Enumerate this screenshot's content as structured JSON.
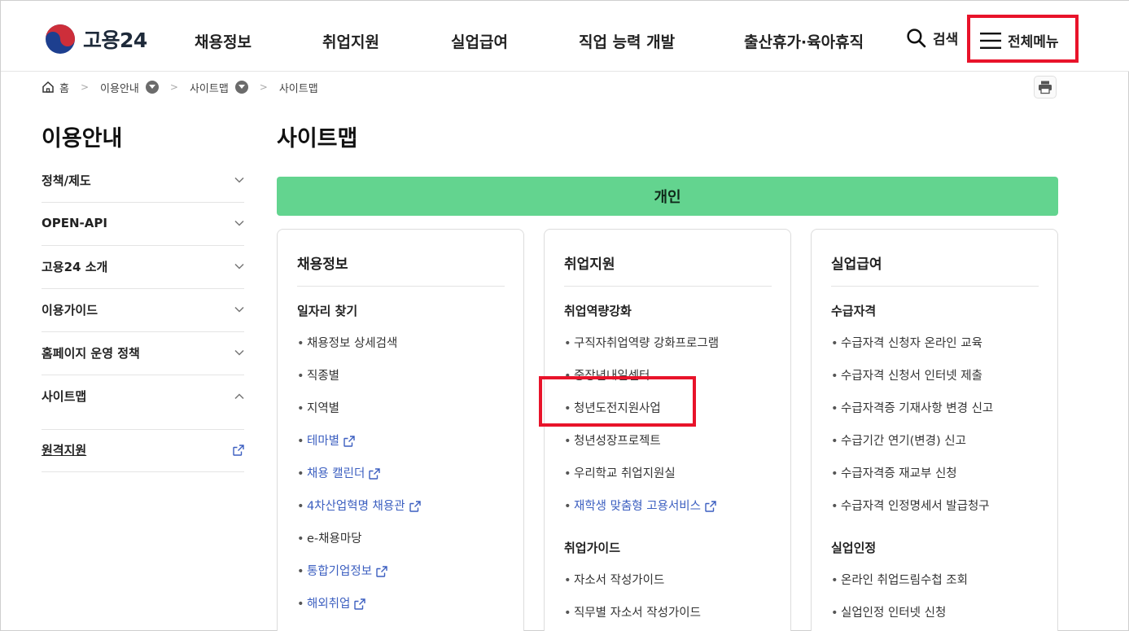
{
  "header": {
    "logo_text": "고용24",
    "nav": [
      "채용정보",
      "취업지원",
      "실업급여",
      "직업 능력 개발",
      "출산휴가·육아휴직"
    ],
    "search_label": "검색",
    "menu_label": "전체메뉴"
  },
  "breadcrumb": {
    "home": "홈",
    "items": [
      "이용안내",
      "사이트맵",
      "사이트맵"
    ]
  },
  "lnb": {
    "title": "이용안내",
    "items": [
      "정책/제도",
      "OPEN-API",
      "고용24 소개",
      "이용가이드",
      "홈페이지 운영 정책",
      "사이트맵"
    ],
    "remote": "원격지원"
  },
  "content": {
    "title": "사이트맵",
    "section": "개인",
    "cards": [
      {
        "title": "채용정보",
        "groups": [
          {
            "title": "일자리 찾기",
            "items": [
              {
                "label": "채용정보 상세검색",
                "external": false
              },
              {
                "label": "직종별",
                "external": false
              },
              {
                "label": "지역별",
                "external": false
              },
              {
                "label": "테마별",
                "external": true
              },
              {
                "label": "채용 캘린더",
                "external": true
              },
              {
                "label": "4차산업혁명 채용관",
                "external": true
              },
              {
                "label": "e-채용마당",
                "external": false
              },
              {
                "label": "통합기업정보",
                "external": true
              },
              {
                "label": "해외취업",
                "external": true
              }
            ]
          }
        ]
      },
      {
        "title": "취업지원",
        "groups": [
          {
            "title": "취업역량강화",
            "items": [
              {
                "label": "구직자취업역량 강화프로그램",
                "external": false
              },
              {
                "label": "중장년내일센터",
                "external": false
              },
              {
                "label": "청년도전지원사업",
                "external": false
              },
              {
                "label": "청년성장프로젝트",
                "external": false
              },
              {
                "label": "우리학교 취업지원실",
                "external": false
              },
              {
                "label": "재학생 맞춤형 고용서비스",
                "external": true
              }
            ]
          },
          {
            "title": "취업가이드",
            "items": [
              {
                "label": "자소서 작성가이드",
                "external": false
              },
              {
                "label": "직무별 자소서 작성가이드",
                "external": false
              }
            ]
          }
        ]
      },
      {
        "title": "실업급여",
        "groups": [
          {
            "title": "수급자격",
            "items": [
              {
                "label": "수급자격 신청자 온라인 교육",
                "external": false
              },
              {
                "label": "수급자격 신청서 인터넷 제출",
                "external": false
              },
              {
                "label": "수급자격증 기재사항 변경 신고",
                "external": false
              },
              {
                "label": "수급기간 연기(변경) 신고",
                "external": false
              },
              {
                "label": "수급자격증 재교부 신청",
                "external": false
              },
              {
                "label": "수급자격 인정명세서 발급청구",
                "external": false
              }
            ]
          },
          {
            "title": "실업인정",
            "items": [
              {
                "label": "온라인 취업드림수첩 조회",
                "external": false
              },
              {
                "label": "실업인정 인터넷 신청",
                "external": false
              }
            ]
          }
        ]
      }
    ]
  },
  "colors": {
    "section_bar": "#63d48f",
    "highlight_box": "#e8132a",
    "external_link": "#3c5fc0"
  }
}
